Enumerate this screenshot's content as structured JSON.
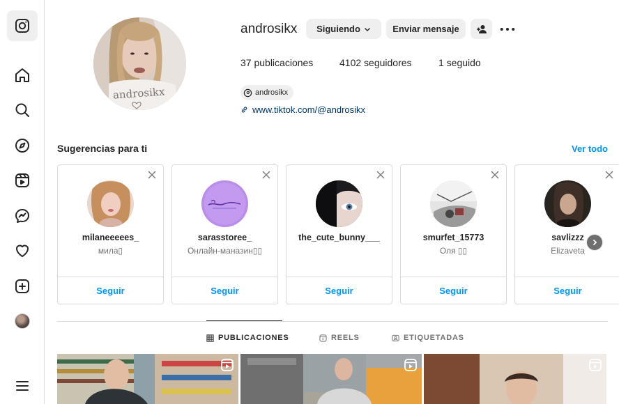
{
  "sidebar": {
    "items": [
      {
        "name": "instagram-logo-icon"
      },
      {
        "name": "home-icon"
      },
      {
        "name": "search-icon"
      },
      {
        "name": "explore-icon"
      },
      {
        "name": "reels-icon"
      },
      {
        "name": "messenger-icon"
      },
      {
        "name": "heart-icon"
      },
      {
        "name": "create-icon"
      },
      {
        "name": "profile-avatar"
      },
      {
        "name": "menu-icon"
      }
    ]
  },
  "profile": {
    "username": "androsikx",
    "following_button": "Siguiendo",
    "message_button": "Enviar mensaje",
    "stats": {
      "posts": "37 publicaciones",
      "followers": "4102 seguidores",
      "following": "1 seguido"
    },
    "threads_handle": "androsikx",
    "link": "www.tiktok.com/@androsikx"
  },
  "suggestions": {
    "title": "Sugerencias para ti",
    "see_all": "Ver todo",
    "follow_label": "Seguir",
    "items": [
      {
        "username": "milaneeeees_",
        "subtitle": "мила▯"
      },
      {
        "username": "sarasstoree_",
        "subtitle": "Онлайн-маназин▯▯"
      },
      {
        "username": "the_cute_bunny___",
        "subtitle": ""
      },
      {
        "username": "smurfet_15773",
        "subtitle": "Оля ▯▯"
      },
      {
        "username": "savlizzz",
        "subtitle": "Elizaveta"
      }
    ]
  },
  "tabs": {
    "posts": "PUBLICACIONES",
    "reels": "REELS",
    "tagged": "ETIQUETADAS"
  },
  "colors": {
    "accent": "#0095f6",
    "text": "#262626",
    "secondary_text": "#737373",
    "border": "#dbdbdb",
    "button_bg": "#efefef"
  }
}
